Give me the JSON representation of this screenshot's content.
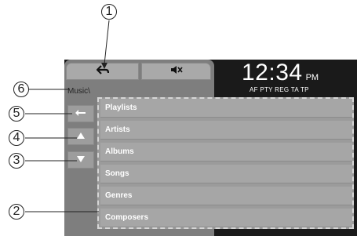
{
  "header": {
    "clock_time": "12:34",
    "clock_ampm": "PM",
    "status_flags": "AF PTY REG TA TP"
  },
  "toolbar": {
    "back_icon": "back-arrow-icon",
    "mute_icon": "mute-speaker-icon"
  },
  "breadcrumb": "Music\\",
  "side": {
    "return_icon": "return-arrow-icon",
    "up_icon": "up-triangle-icon",
    "down_icon": "down-triangle-icon"
  },
  "list": {
    "items": [
      {
        "label": "Playlists"
      },
      {
        "label": "Artists"
      },
      {
        "label": "Albums"
      },
      {
        "label": "Songs"
      },
      {
        "label": "Genres"
      },
      {
        "label": "Composers"
      }
    ]
  },
  "callouts": [
    "1",
    "2",
    "3",
    "4",
    "5",
    "6"
  ]
}
